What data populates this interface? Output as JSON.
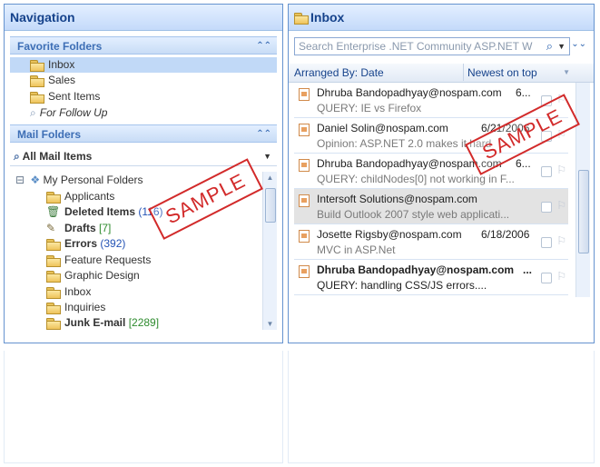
{
  "navigation": {
    "title": "Navigation",
    "favorites_title": "Favorite Folders",
    "favorites": [
      {
        "label": "Inbox",
        "selected": true
      },
      {
        "label": "Sales"
      },
      {
        "label": "Sent Items"
      },
      {
        "label": "For Follow Up"
      }
    ],
    "mail_folders_title": "Mail Folders",
    "all_mail_items": "All Mail Items",
    "root": "My Personal Folders",
    "folders": [
      {
        "label": "Applicants",
        "count": "",
        "bold": false
      },
      {
        "label": "Deleted Items",
        "count": "(116)",
        "bold": true
      },
      {
        "label": "Drafts",
        "count": "[7]",
        "bold": true
      },
      {
        "label": "Errors",
        "count": "(392)",
        "bold": true
      },
      {
        "label": "Feature Requests",
        "count": "",
        "bold": false
      },
      {
        "label": "Graphic Design",
        "count": "",
        "bold": false
      },
      {
        "label": "Inbox",
        "count": "",
        "bold": false
      },
      {
        "label": "Inquiries",
        "count": "",
        "bold": false
      },
      {
        "label": "Junk E-mail",
        "count": "[2289]",
        "bold": true
      }
    ],
    "expander": "⊟",
    "stamp": "SAMPLE"
  },
  "inbox": {
    "title": "Inbox",
    "search_placeholder": "Search Enterprise .NET Community  ASP.NET  W",
    "arranged_by": "Arranged By: Date",
    "sort_order": "Newest on top",
    "messages": [
      {
        "from": "Dhruba Bandopadhyay@nospam.com",
        "date": "6...",
        "subject": "QUERY: IE vs Firefox",
        "unread": false
      },
      {
        "from": "Daniel Solin@nospam.com",
        "date": "6/21/2006",
        "subject": "Opinion: ASP.NET 2.0 makes it hard",
        "unread": false
      },
      {
        "from": "Dhruba Bandopadhyay@nospam.com",
        "date": "6...",
        "subject": "QUERY: childNodes[0] not working in F...",
        "unread": false
      },
      {
        "from": "Intersoft Solutions@nospam.com",
        "date": "",
        "subject": "Build Outlook 2007 style web applicati...",
        "unread": false,
        "selected": true
      },
      {
        "from": "Josette Rigsby@nospam.com",
        "date": "6/18/2006",
        "subject": "MVC in ASP.Net",
        "unread": false
      },
      {
        "from": "Dhruba Bandopadhyay@nospam.com",
        "date": "...",
        "subject": "QUERY: handling CSS/JS errors....",
        "unread": true
      }
    ],
    "stamp": "SAMPLE"
  },
  "colors": {
    "accent": "#15428b",
    "stamp": "#d22a2a",
    "selection": "#c1d9f7"
  }
}
